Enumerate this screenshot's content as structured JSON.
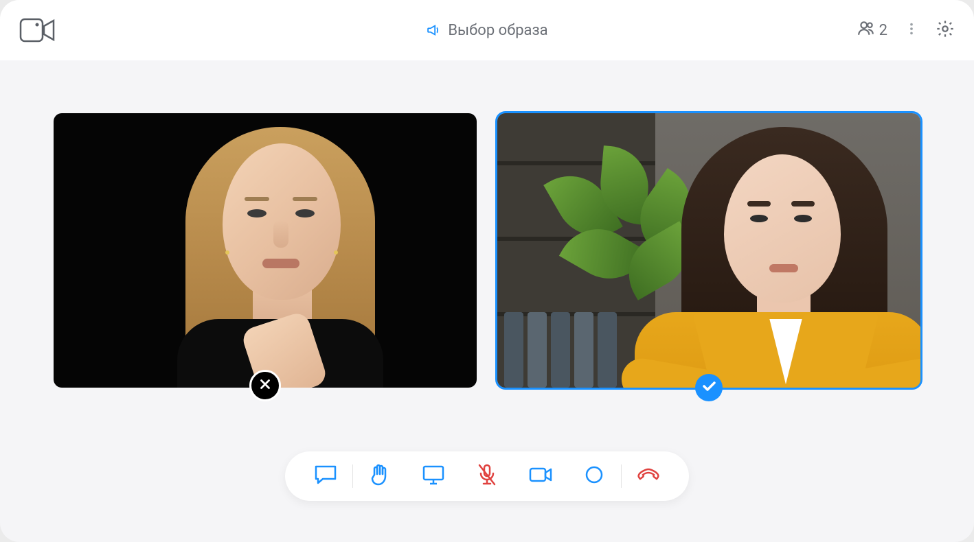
{
  "header": {
    "title": "Выбор образа",
    "participant_count": "2"
  },
  "tiles": [
    {
      "selected": false,
      "status_icon": "reject-icon"
    },
    {
      "selected": true,
      "status_icon": "accept-icon"
    }
  ],
  "controls": {
    "chat": "chat-icon",
    "raisehand": "hand-icon",
    "screen": "screen-share-icon",
    "mic": "microphone-muted-icon",
    "camera": "camera-icon",
    "record": "record-icon",
    "hangup": "hangup-icon"
  },
  "colors": {
    "accent": "#1a91ff",
    "danger": "#e0423f",
    "muted": "#6b6f76"
  }
}
